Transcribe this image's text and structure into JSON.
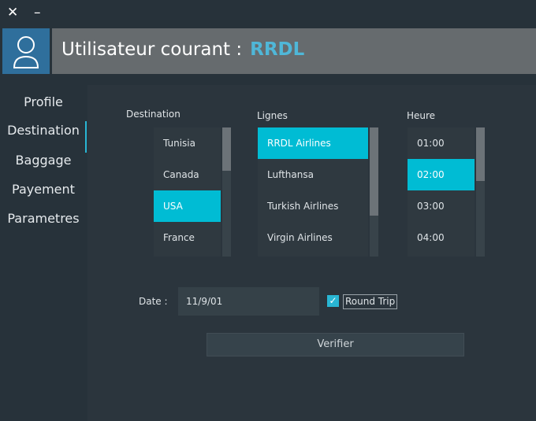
{
  "window": {
    "close_glyph": "✕",
    "minimize_glyph": "–"
  },
  "header": {
    "title": "Utilisateur courant :",
    "username": "RRDL",
    "avatar_icon": "user-icon",
    "accent_color": "#4fb7d8"
  },
  "sidebar": {
    "items": [
      {
        "label": "Profile",
        "active": false
      },
      {
        "label": "Destination",
        "active": true
      },
      {
        "label": "Baggage",
        "active": false
      },
      {
        "label": "Payement",
        "active": false
      },
      {
        "label": "Parametres",
        "active": false
      }
    ]
  },
  "destination": {
    "label": "Destination",
    "items": [
      "Tunisia",
      "Canada",
      "USA",
      "France"
    ],
    "selected": "USA"
  },
  "lignes": {
    "label": "Lignes",
    "items": [
      "RRDL Airlines",
      "Lufthansa",
      "Turkish Airlines",
      "Virgin Airlines"
    ],
    "selected": "RRDL Airlines"
  },
  "heure": {
    "label": "Heure",
    "items": [
      "01:00",
      "02:00",
      "03:00",
      "04:00"
    ],
    "selected": "02:00"
  },
  "date": {
    "label": "Date :",
    "value": "11/9/01"
  },
  "round_trip": {
    "label": "Round Trip",
    "checked": true,
    "check_glyph": "✓"
  },
  "verify_button": {
    "label": "Verifier"
  },
  "colors": {
    "selection": "#00bcd4",
    "avatar_bg": "#2f6f9c",
    "header_bar": "#666b6e"
  }
}
